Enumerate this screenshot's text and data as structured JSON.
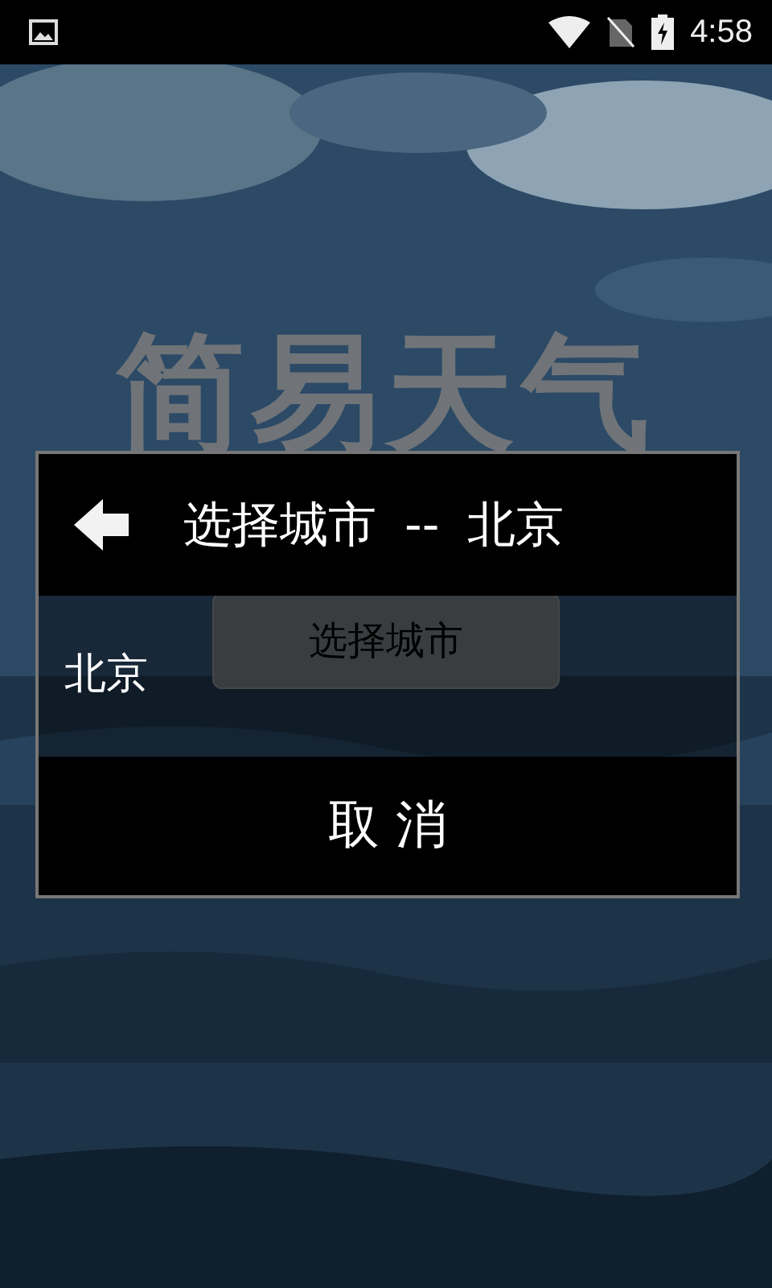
{
  "status_bar": {
    "time": "4:58"
  },
  "app": {
    "title": "简易天气",
    "select_button": "选择城市"
  },
  "dialog": {
    "title": "选择城市 -- 北京",
    "items": [
      {
        "label": "北京"
      }
    ],
    "cancel_button": "取 消"
  }
}
